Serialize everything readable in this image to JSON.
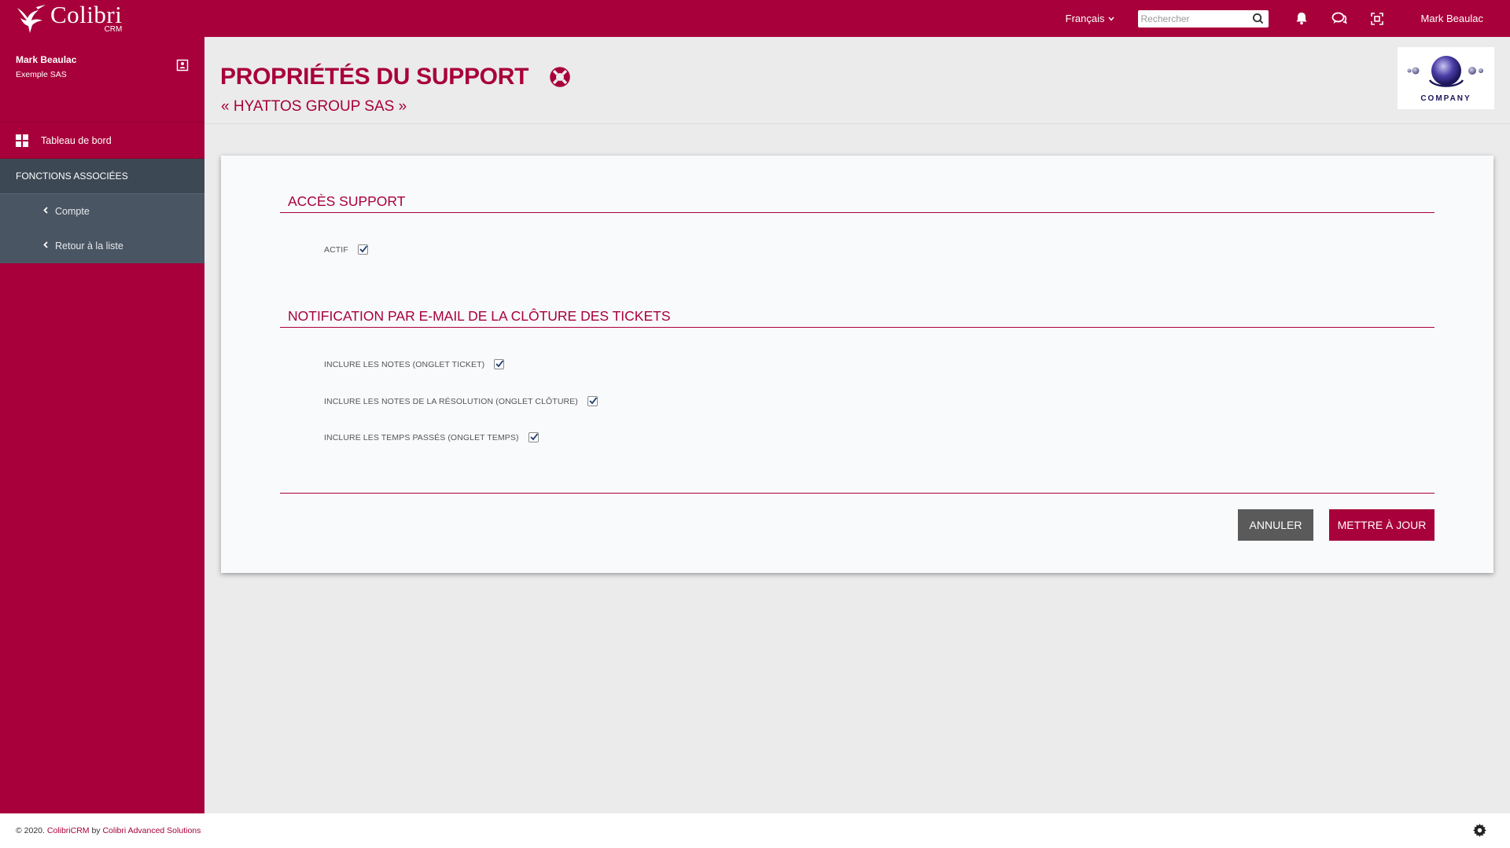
{
  "brand": {
    "name": "Colibri",
    "sub": "CRM"
  },
  "topbar": {
    "language": "Français",
    "search_placeholder": "Rechercher",
    "user": "Mark Beaulac"
  },
  "sidebar": {
    "profile": {
      "name": "Mark Beaulac",
      "company": "Exemple SAS"
    },
    "dashboard_label": "Tableau de bord",
    "associated_title": "FONCTIONS ASSOCIÉES",
    "items": [
      {
        "label": "Compte"
      },
      {
        "label": "Retour à la liste"
      }
    ]
  },
  "header": {
    "title": "PROPRIÉTÉS DU SUPPORT",
    "subtitle": "« HYATTOS GROUP SAS »",
    "logo_text": "COMPANY"
  },
  "form": {
    "section1": {
      "title": "ACCÈS SUPPORT",
      "fields": [
        {
          "label": "ACTIF",
          "checked": true
        }
      ]
    },
    "section2": {
      "title": "NOTIFICATION PAR E-MAIL DE LA CLÔTURE DES TICKETS",
      "fields": [
        {
          "label": "INCLURE LES NOTES (ONGLET TICKET)",
          "checked": true
        },
        {
          "label": "INCLURE LES NOTES DE LA RÉSOLUTION (ONGLET CLÔTURE)",
          "checked": true
        },
        {
          "label": "INCLURE LES TEMPS PASSÉS (ONGLET TEMPS)",
          "checked": true
        }
      ]
    },
    "cancel_label": "ANNULER",
    "update_label": "METTRE À JOUR"
  },
  "footer": {
    "prefix": "© 2020.",
    "product": "ColibriCRM",
    "by": "by",
    "company": "Colibri Advanced Solutions"
  },
  "colors": {
    "brand": "#a8003a",
    "sidebar_dark": "#4a5563",
    "cancel": "#5a5a5a"
  }
}
